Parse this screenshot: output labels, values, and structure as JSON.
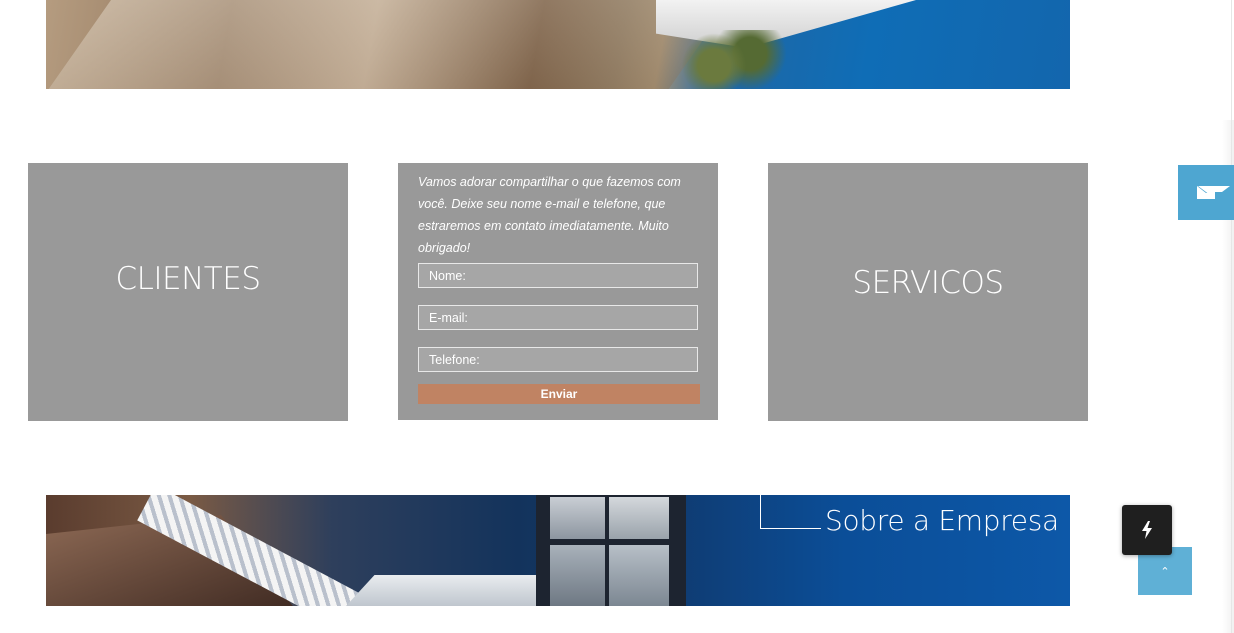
{
  "banners": {
    "bottom_title": "Sobre a Empresa"
  },
  "tiles": {
    "clientes_label": "CLIENTES",
    "servicos_label": "SERVICOS"
  },
  "contact_form": {
    "intro": "Vamos adorar compartilhar o que fazemos com você. Deixe seu nome e-mail e telefone, que estraremos em contato imediatamente. Muito obrigado!",
    "name_placeholder": "Nome:",
    "email_placeholder": "E-mail:",
    "phone_placeholder": "Telefone:",
    "submit_label": "Enviar"
  },
  "floating": {
    "contact_icon": "envelope-icon",
    "quick_icon": "lightning-bolt-icon",
    "top_icon": "chevron-up-icon"
  },
  "colors": {
    "tile_gray": "#999999",
    "submit_button": "#c08363",
    "accent_blue": "#4ea6d1",
    "dark_button": "#1f1f1f"
  }
}
